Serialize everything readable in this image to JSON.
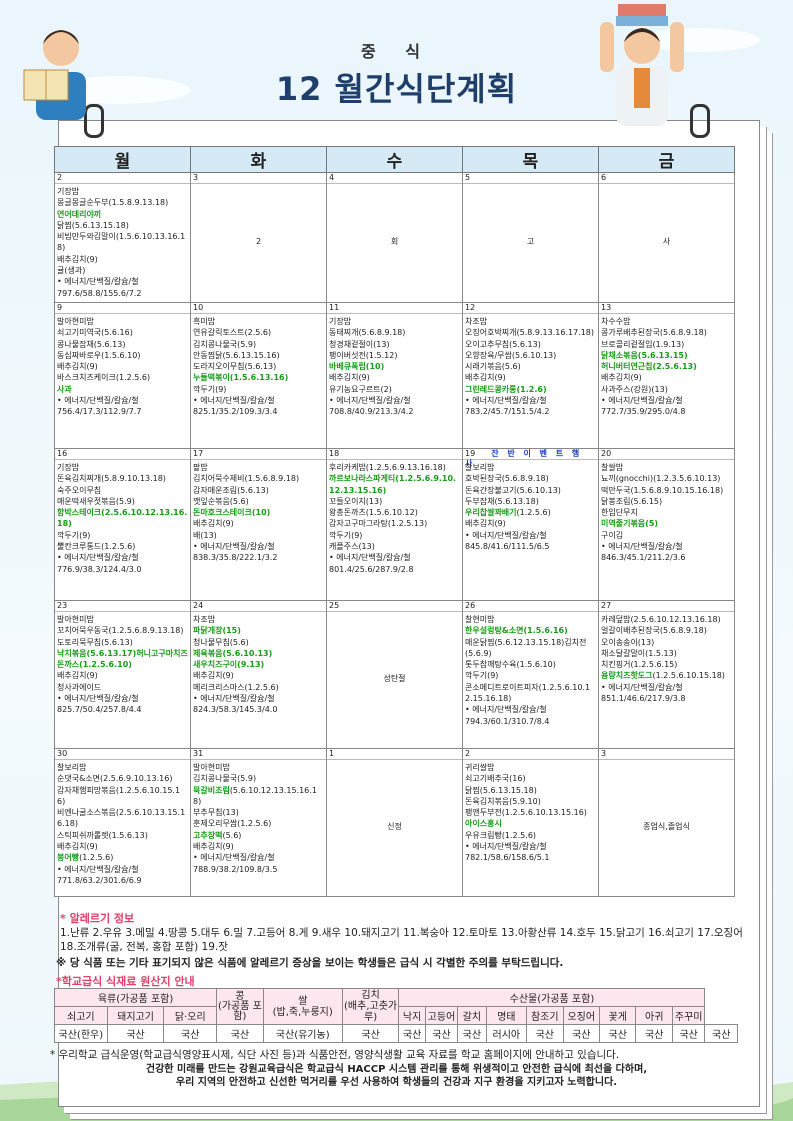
{
  "header": {
    "subtitle": "중 식",
    "title": "12 월간식단계획"
  },
  "days": [
    "월",
    "화",
    "수",
    "목",
    "금"
  ],
  "weeks": [
    [
      {
        "date": "2",
        "meals": [
          [
            "기장밥",
            0
          ],
          [
            "몽글몽글순두부(1.5.8.9.13.18)",
            0
          ],
          [
            "연어데리야끼",
            1
          ],
          [
            "닭찜(5.6.13.15.18)",
            0
          ],
          [
            "비빔만두와김말이(1.5.6.10.13.16.18)",
            0
          ],
          [
            "배추김치(9)",
            0
          ],
          [
            "귤(생과)",
            0
          ],
          [
            "• 에너지/단백질/칼슘/철",
            0
          ],
          [
            "797.6/58.8/155.6/7.2",
            0
          ]
        ]
      },
      {
        "date": "3",
        "center": "2"
      },
      {
        "date": "4",
        "center": "회"
      },
      {
        "date": "5",
        "center": "고"
      },
      {
        "date": "6",
        "center": "사"
      }
    ],
    [
      {
        "date": "9",
        "meals": [
          [
            "발아현미밥",
            0
          ],
          [
            "쇠고기미역국(5.6.16)",
            0
          ],
          [
            "콩나물잡채(5.6.13)",
            0
          ],
          [
            "동심짜바로우(1.5.6.10)",
            0
          ],
          [
            "배추김치(9)",
            0
          ],
          [
            "바스크치즈케이크(1.2.5.6)",
            0
          ],
          [
            "사과",
            1
          ],
          [
            "• 에너지/단백질/칼슘/철",
            0
          ],
          [
            "756.4/17.3/112.9/7.7",
            0
          ]
        ]
      },
      {
        "date": "10",
        "meals": [
          [
            "흑미밥",
            0
          ],
          [
            "연유갈릭토스트(2.5.6)",
            0
          ],
          [
            "김치콩나물국(5.9)",
            0
          ],
          [
            "안동찜닭(5.6.13.15.16)",
            0
          ],
          [
            "도라지오이무침(5.6.13)",
            0
          ],
          [
            "누들떡볶이(1.5.6.13.16)",
            1
          ],
          [
            "깍두기(9)",
            0
          ],
          [
            "• 에너지/단백질/칼슘/철",
            0
          ],
          [
            "825.1/35.2/109.3/3.4",
            0
          ]
        ]
      },
      {
        "date": "11",
        "meals": [
          [
            "기장밥",
            0
          ],
          [
            "동태찌개(5.6.8.9.18)",
            0
          ],
          [
            "청경채겉절이(13)",
            0
          ],
          [
            "팽이버섯전(1.5.12)",
            0
          ],
          [
            "바베큐폭립(10)",
            1
          ],
          [
            "배추김치(9)",
            0
          ],
          [
            "유기농요구르트(2)",
            0
          ],
          [
            "• 에너지/단백질/칼슘/철",
            0
          ],
          [
            "708.8/40.9/213.3/4.2",
            0
          ]
        ]
      },
      {
        "date": "12",
        "meals": [
          [
            "차조밥",
            0
          ],
          [
            "오징어호박찌개(5.8.9.13.16.17.18)",
            0
          ],
          [
            "오이고추무침(5.6.13)",
            0
          ],
          [
            "오향장육/무쌈(5.6.10.13)",
            0
          ],
          [
            "시래기볶음(5.6)",
            0
          ],
          [
            "배추김치(9)",
            0
          ],
          [
            "그린레드콩카롱(1.2.6)",
            1
          ],
          [
            "• 에너지/단백질/칼슘/철",
            0
          ],
          [
            "783.2/45.7/151.5/4.2",
            0
          ]
        ]
      },
      {
        "date": "13",
        "meals": [
          [
            "차수수밥",
            0
          ],
          [
            "콩가루배추된장국(5.6.8.9.18)",
            0
          ],
          [
            "브로콜리겉절임(1.9.13)",
            0
          ],
          [
            "닭채소볶음(5.6.13.15)",
            1
          ],
          [
            "허니버터연근칩(2.5.6.13)",
            1
          ],
          [
            "배추김치(9)",
            0
          ],
          [
            "사과주스(강원)(13)",
            0
          ],
          [
            "• 에너지/단백질/칼슘/철",
            0
          ],
          [
            "772.7/35.9/295.0/4.8",
            0
          ]
        ]
      }
    ],
    [
      {
        "date": "16",
        "meals": [
          [
            "기장밥",
            0
          ],
          [
            "돈육김치찌개(5.8.9.10.13.18)",
            0
          ],
          [
            "숙주오이무침",
            0
          ],
          [
            "매운떡새우젓볶음(5.9)",
            0
          ],
          [
            "함박스테이크(2.5.6.10.12.13.16.18)",
            1
          ],
          [
            "깍두기(9)",
            0
          ],
          [
            "뿔칸크루통드(1.2.5.6)",
            0
          ],
          [
            "• 에너지/단백질/칼슘/철",
            0
          ],
          [
            "776.9/38.3/124.4/3.0",
            0
          ]
        ]
      },
      {
        "date": "17",
        "meals": [
          [
            "팥밥",
            0
          ],
          [
            "김치어묵수제비(1.5.6.8.9.18)",
            0
          ],
          [
            "감자매운조림(5.6.13)",
            0
          ],
          [
            "깻잎순볶음(5.6)",
            0
          ],
          [
            "돈마호크스테이크(10)",
            1
          ],
          [
            "배추김치(9)",
            0
          ],
          [
            "배(13)",
            0
          ],
          [
            "• 에너지/단백질/칼슘/철",
            0
          ],
          [
            "838.3/35.8/222.1/3.2",
            0
          ]
        ]
      },
      {
        "date": "18",
        "meals": [
          [
            "후리카케밥(1.2.5.6.9.13.16.18)",
            0
          ],
          [
            "까르보나라스파게티(1.2.5.6.9.10.12.13.15.16)",
            1
          ],
          [
            "꼬들오이지(13)",
            0
          ],
          [
            "왕총돈까츠(1.5.6.10.12)",
            0
          ],
          [
            "감자고구마그라탕(1.2.5.13)",
            0
          ],
          [
            "깍두기(9)",
            0
          ],
          [
            "캐플주스(13)",
            0
          ],
          [
            "• 에너지/단백질/칼슘/철",
            0
          ],
          [
            "801.4/25.6/287.9/2.8",
            0
          ]
        ]
      },
      {
        "date": "19",
        "event": "잔 반 이 벤 트 행 사",
        "meals": [
          [
            "찰보리밥",
            0
          ],
          [
            "호박된장국(5.6.8.9.18)",
            0
          ],
          [
            "돈육간장불고기(5.6.10.13)",
            0
          ],
          [
            "두부잡채(5.6.13.18)",
            0
          ],
          [
            "우리찹쌀꽈배기",
            1,
            "(1.2.5.6)"
          ],
          [
            "배추김치(9)",
            0
          ],
          [
            "• 에너지/단백질/칼슘/철",
            0
          ],
          [
            "845.8/41.6/111.5/6.5",
            0
          ]
        ]
      },
      {
        "date": "20",
        "meals": [
          [
            "찰쌀밥",
            0
          ],
          [
            "뇨끼(gnocchi)(1.2.3.5.6.10.13)",
            0
          ],
          [
            "떡만두국(1.5.6.8.9.10.15.16.18)",
            0
          ],
          [
            "닭봉조림(5.6.15)",
            0
          ],
          [
            "한입단무지",
            0
          ],
          [
            "미역줄기볶음(5)",
            1
          ],
          [
            "구이김",
            0
          ],
          [
            "• 에너지/단백질/칼슘/철",
            0
          ],
          [
            "846.3/45.1/211.2/3.6",
            0
          ]
        ]
      }
    ],
    [
      {
        "date": "23",
        "meals": [
          [
            "발아현미밥",
            0
          ],
          [
            "꼬치어묵우동국(1.2.5.6.8.9.13.18)",
            0
          ],
          [
            "도토리묵무침(5.6.13)",
            0
          ],
          [
            "낙지볶음(5.6.13.17)허니고구마치즈돈까스(1.2.5.6.10)",
            1
          ],
          [
            "배추김치(9)",
            0
          ],
          [
            "청사과에이드",
            0
          ],
          [
            "• 에너지/단백질/칼슘/철",
            0
          ],
          [
            "825.7/50.4/257.8/4.4",
            0
          ]
        ]
      },
      {
        "date": "24",
        "meals": [
          [
            "차조밥",
            0
          ],
          [
            "파닭개장(15)",
            1
          ],
          [
            "청나물무침(5.6)",
            0
          ],
          [
            "제육볶음(5.6.10.13)",
            1
          ],
          [
            "새우치즈구이(9.13)",
            1
          ],
          [
            "배추김치(9)",
            0
          ],
          [
            "메리크리스마스(1.2.5.6)",
            0
          ],
          [
            "• 에너지/단백질/칼슘/철",
            0
          ],
          [
            "824.3/58.3/145.3/4.0",
            0
          ]
        ]
      },
      {
        "date": "25",
        "center": "성탄절"
      },
      {
        "date": "26",
        "meals": [
          [
            "찰현미밥",
            0
          ],
          [
            "한우설렁탕&소면(1.5.6.16)",
            1
          ],
          [
            "매운닭찜(5.6.12.13.15.18)김치전(5.6.9)",
            0
          ],
          [
            "톳두참깨탕수육(1.5.6.10)",
            0
          ],
          [
            "깍두기(9)",
            0
          ],
          [
            "콘소메디트로이트피자(1.2.5.6.10.12.15.16.18)",
            0
          ],
          [
            "• 에너지/단백질/칼슘/철",
            0
          ],
          [
            "794.3/60.1/310.7/8.4",
            0
          ]
        ]
      },
      {
        "date": "27",
        "meals": [
          [
            "카레덮밥(2.5.6.10.12.13.16.18)",
            0
          ],
          [
            "얼갈이배추된장국(5.6.8.9.18)",
            0
          ],
          [
            "오이송송이(13)",
            0
          ],
          [
            "채소달걀말이(1.5.13)",
            0
          ],
          [
            "치킨핑거(1.2.5.6.15)",
            0
          ],
          [
            "용량치즈핫도그",
            1,
            "(1.2.5.6.10.15.18)"
          ],
          [
            "• 에너지/단백질/칼슘/철",
            0
          ],
          [
            "851.1/46.6/217.9/3.8",
            0
          ]
        ]
      }
    ],
    [
      {
        "date": "30",
        "meals": [
          [
            "찰보리밥",
            0
          ],
          [
            "순댓국&소면(2.5.6.9.10.13.16)",
            0
          ],
          [
            "감자채햄피망볶음(1.2.5.6.10.15.16)",
            0
          ],
          [
            "비엔나굴소스볶음(2.5.6.10.13.15.16.18)",
            0
          ],
          [
            "스틱피쉬까롤렛(1.5.6.13)",
            0
          ],
          [
            "배추김치(9)",
            0
          ],
          [
            "붕어빵",
            1,
            "(1.2.5.6)"
          ],
          [
            "• 에너지/단백질/칼슘/철",
            0
          ],
          [
            "771.8/63.2/301.6/6.9",
            0
          ]
        ]
      },
      {
        "date": "31",
        "meals": [
          [
            "발아현미밥",
            0
          ],
          [
            "김치콩나물국(5.9)",
            0
          ],
          [
            "묵갈비조림",
            1,
            "(5.6.10.12.13.15.16.18)"
          ],
          [
            "부추무침(13)",
            0
          ],
          [
            "훈제오리무쌈(1.2.5.6)",
            0
          ],
          [
            "고추장떡",
            1,
            "(5.6)"
          ],
          [
            "배추김치(9)",
            0
          ],
          [
            "• 에너지/단백질/칼슘/철",
            0
          ],
          [
            "788.9/38.2/109.8/3.5",
            0
          ]
        ]
      },
      {
        "date": "1",
        "center": "신정"
      },
      {
        "date": "2",
        "meals": [
          [
            "귀리쌀밥",
            0
          ],
          [
            "쇠고기배추국(16)",
            0
          ],
          [
            "닭찜(5.6.13.15.18)",
            0
          ],
          [
            "돈육김치볶음(5.9.10)",
            0
          ],
          [
            "팽앤두부전(1.2.5.6.10.13.15.16)",
            0
          ],
          [
            "아이스홍시",
            1
          ],
          [
            "우유크림빵(1.2.5.6)",
            0
          ],
          [
            "• 에너지/단백질/칼슘/철",
            0
          ],
          [
            "782.1/58.6/158.6/5.1",
            0
          ]
        ]
      },
      {
        "date": "3",
        "center": "종업식,졸업식"
      }
    ]
  ],
  "allergy": {
    "heading": "* 알레르기 정보",
    "text": "1.난류 2.우유 3.메밀 4.땅콩 5.대두 6.밀 7.고등어 8.게 9.새우 10.돼지고기 11.복숭아 12.토마토 13.아황산류 14.호두 15.닭고기 16.쇠고기 17.오징어 18.조개류(굴, 전복, 홍합 포함) 19.잣",
    "warning": "※ 당 식품 또는 기타 표기되지 않은 식품에 알레르기 증상을 보이는 학생들은 급식 시 각별한 주의를 부탁드립니다."
  },
  "origin": {
    "heading": "*학교급식 식재료 원산지 안내",
    "group_meat": "육류(가공품 포함)",
    "bean": "콩\n(가공품 포함)",
    "rice": "쌀\n(밥,죽,누룽지)",
    "kimchi": "김치\n(배추,고춧가루)",
    "group_fish": "수산물(가공품 포함)",
    "sub": [
      "쇠고기",
      "돼지고기",
      "닭·오리",
      "낙지",
      "고등어",
      "갈치",
      "명태",
      "참조기",
      "오징어",
      "꽃게",
      "아귀",
      "주꾸미"
    ],
    "values": [
      "국산(한우)",
      "국산",
      "국산",
      "국산",
      "국산(유기농)",
      "국산",
      "국산",
      "국산",
      "국산",
      "러시아",
      "국산",
      "국산",
      "국산",
      "국산",
      "국산",
      "국산"
    ]
  },
  "footer": {
    "line1": "* 우리학교 급식운영(학교급식영양표시제, 식단 사진 등)과 식품안전, 영양식생활 교육 자료를 학교 홈페이지에 안내하고 있습니다.",
    "line2": "건강한 미래를 만드는 강원교육급식은 학교급식 HACCP 시스템 관리를 통해 위생적이고 안전한 급식에 최선을 다하며,",
    "line3": "우리 지역의 안전하고 신선한 먹거리를 우선 사용하여 학생들의 건강과 지구 환경을 지키고자 노력합니다."
  }
}
